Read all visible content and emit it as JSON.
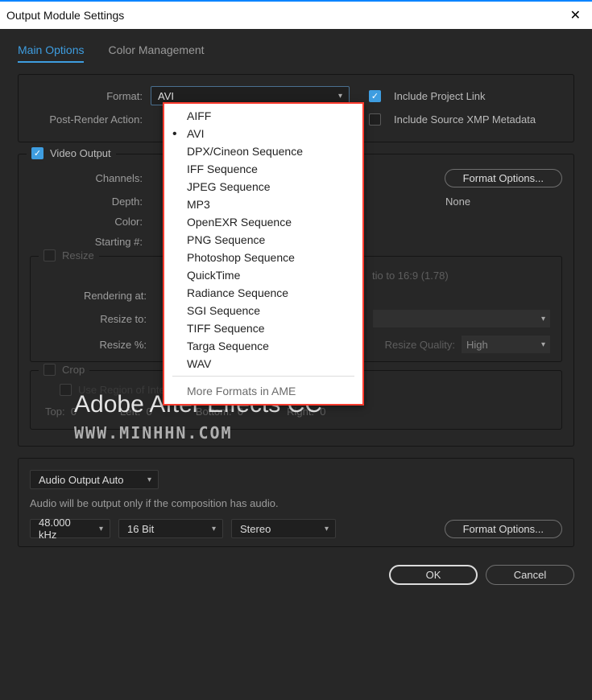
{
  "window": {
    "title": "Output Module Settings"
  },
  "tabs": {
    "main": "Main Options",
    "color": "Color Management"
  },
  "format": {
    "label": "Format:",
    "value": "AVI",
    "options": [
      "AIFF",
      "AVI",
      "DPX/Cineon Sequence",
      "IFF Sequence",
      "JPEG Sequence",
      "MP3",
      "OpenEXR Sequence",
      "PNG Sequence",
      "Photoshop Sequence",
      "QuickTime",
      "Radiance Sequence",
      "SGI Sequence",
      "TIFF Sequence",
      "Targa Sequence",
      "WAV"
    ],
    "more": "More Formats in AME"
  },
  "postRender": {
    "label": "Post-Render Action:"
  },
  "include": {
    "projectLink": "Include Project Link",
    "xmp": "Include Source XMP Metadata"
  },
  "videoOutput": {
    "legend": "Video Output",
    "channels": "Channels:",
    "depth": "Depth:",
    "color": "Color:",
    "starting": "Starting #:",
    "formatOptions": "Format Options...",
    "none": "None"
  },
  "resize": {
    "legend": "Resize",
    "ratio": "tio to 16:9 (1.78)",
    "renderingAt": "Rendering at:",
    "resizeTo": "Resize to:",
    "resizePct": "Resize %:",
    "quality": "Resize Quality:",
    "qualityVal": "High"
  },
  "crop": {
    "legend": "Crop",
    "useRegion": "Use Region of Interest",
    "top": "Top:",
    "left": "Left:",
    "bottom": "Bottom:",
    "right": "Right:",
    "zero": "0"
  },
  "audio": {
    "mode": "Audio Output Auto",
    "note": "Audio will be output only if the composition has audio.",
    "rate": "48.000 kHz",
    "depth": "16 Bit",
    "channels": "Stereo",
    "formatOptions": "Format Options..."
  },
  "buttons": {
    "ok": "OK",
    "cancel": "Cancel"
  },
  "watermark": {
    "l1": "Adobe After Effects CC",
    "l2": "WWW.MINHHN.COM"
  }
}
